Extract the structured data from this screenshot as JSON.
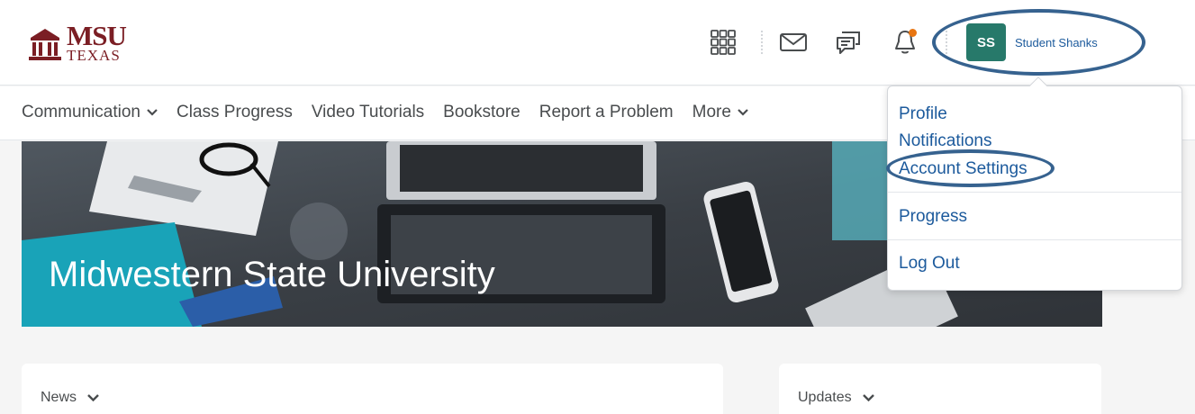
{
  "header": {
    "logo": {
      "line1": "MSU",
      "line2": "TEXAS"
    },
    "icons": [
      "waffle-icon",
      "mail-icon",
      "chat-icon",
      "bell-icon"
    ],
    "user": {
      "initials": "SS",
      "name": "Student Shanks"
    }
  },
  "nav": {
    "items": [
      {
        "label": "Communication",
        "has_dropdown": true
      },
      {
        "label": "Class Progress",
        "has_dropdown": false
      },
      {
        "label": "Video Tutorials",
        "has_dropdown": false
      },
      {
        "label": "Bookstore",
        "has_dropdown": false
      },
      {
        "label": "Report a Problem",
        "has_dropdown": false
      },
      {
        "label": "More",
        "has_dropdown": true
      }
    ]
  },
  "banner": {
    "title": "Midwestern State University"
  },
  "widgets": {
    "news": "News",
    "updates": "Updates"
  },
  "dropdown": {
    "profile": "Profile",
    "notifications": "Notifications",
    "account_settings": "Account Settings",
    "progress": "Progress",
    "log_out": "Log Out"
  },
  "colors": {
    "brand": "#7b1e24",
    "avatar": "#27796a",
    "link": "#1c5a9c",
    "highlight": "#36628f",
    "badge": "#e87511"
  }
}
